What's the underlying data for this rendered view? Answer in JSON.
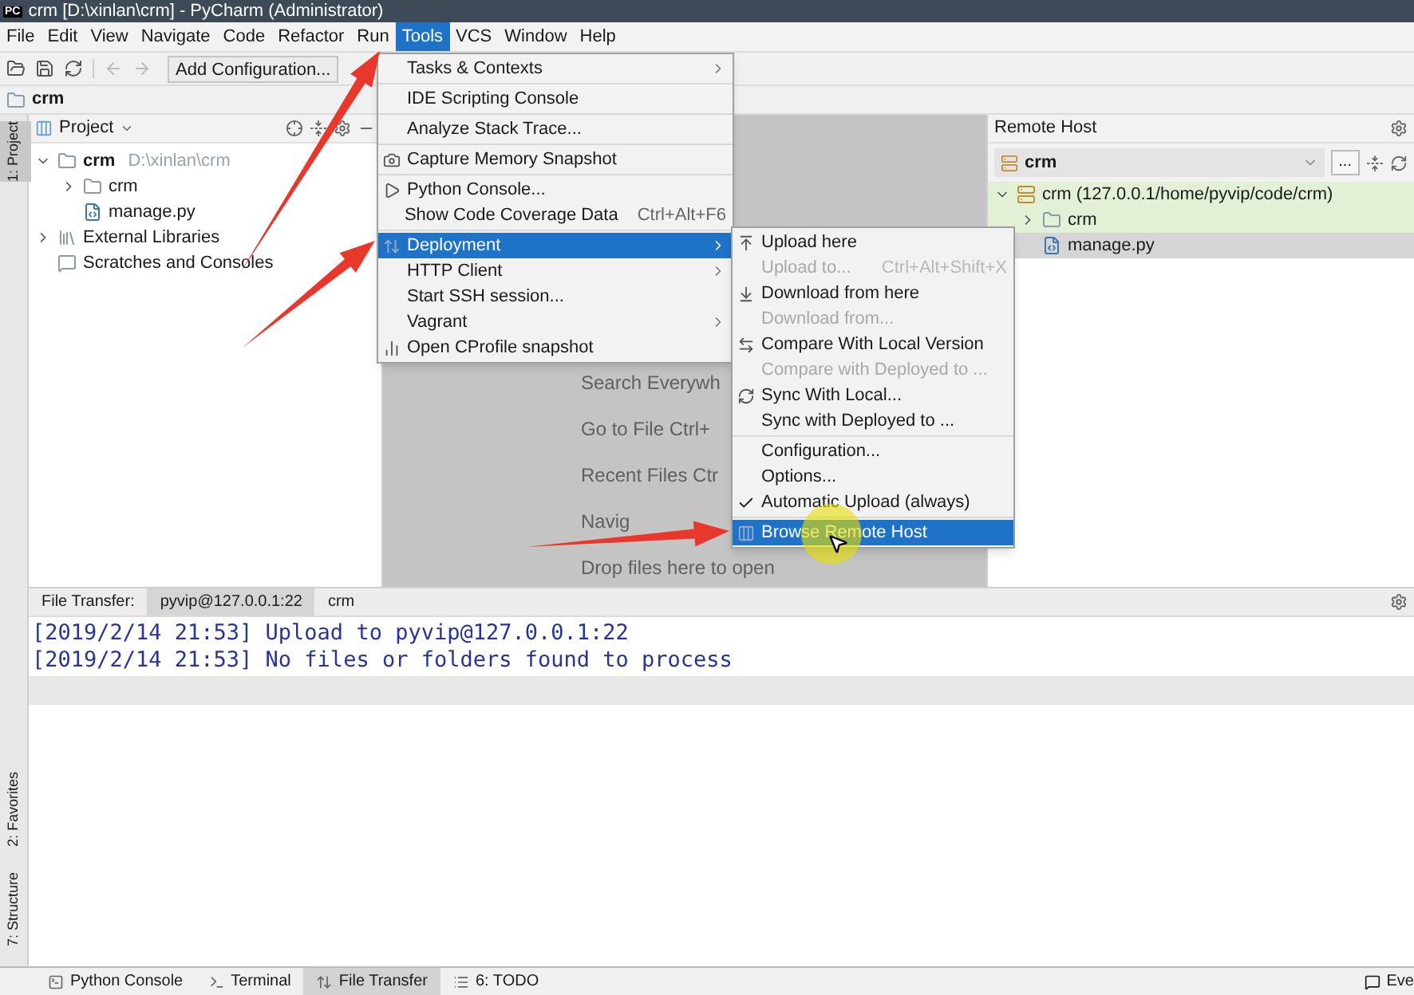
{
  "window": {
    "logo": "PC",
    "title": "crm [D:\\xinlan\\crm] - PyCharm (Administrator)"
  },
  "menu_bar": [
    {
      "label": "File",
      "selected": false
    },
    {
      "label": "Edit",
      "selected": false
    },
    {
      "label": "View",
      "selected": false
    },
    {
      "label": "Navigate",
      "selected": false
    },
    {
      "label": "Code",
      "selected": false
    },
    {
      "label": "Refactor",
      "selected": false
    },
    {
      "label": "Run",
      "selected": false
    },
    {
      "label": "Tools",
      "selected": true
    },
    {
      "label": "VCS",
      "selected": false
    },
    {
      "label": "Window",
      "selected": false
    },
    {
      "label": "Help",
      "selected": false
    }
  ],
  "toolbar": {
    "config_button": "Add Configuration..."
  },
  "breadcrumb": "crm",
  "left_stripe": {
    "top": "1: Project",
    "bottom": [
      "2: Favorites",
      "7: Structure"
    ]
  },
  "project_panel": {
    "title": "Project",
    "tree": [
      {
        "name": "crm",
        "path": "D:\\xinlan\\crm",
        "kind": "folder",
        "expanded": true,
        "children": [
          {
            "name": "crm",
            "kind": "folder",
            "expanded": false
          },
          {
            "name": "manage.py",
            "kind": "python"
          }
        ]
      },
      {
        "name": "External Libraries",
        "kind": "library",
        "expanded": false
      },
      {
        "name": "Scratches and Consoles",
        "kind": "scratch"
      }
    ]
  },
  "editor_hints": [
    "Search Everywh",
    "Go to File Ctrl+",
    "Recent Files Ctr",
    "Navig",
    "Drop files here to open"
  ],
  "tools_menu": {
    "items": [
      {
        "kind": "item",
        "label": "Tasks & Contexts",
        "submenu": true,
        "selected": false
      },
      {
        "kind": "separator"
      },
      {
        "kind": "item",
        "label": "IDE Scripting Console",
        "selected": false
      },
      {
        "kind": "separator"
      },
      {
        "kind": "item",
        "label": "Analyze Stack Trace...",
        "selected": false
      },
      {
        "kind": "separator"
      },
      {
        "kind": "item",
        "label": "Capture Memory Snapshot",
        "selected": false
      },
      {
        "kind": "separator"
      },
      {
        "kind": "item",
        "label": "Python Console...",
        "selected": false
      },
      {
        "kind": "item",
        "label": "Show Code Coverage Data",
        "shortcut": "Ctrl+Alt+F6",
        "selected": false
      },
      {
        "kind": "separator"
      },
      {
        "kind": "item",
        "label": "Deployment",
        "submenu": true,
        "selected": true
      },
      {
        "kind": "item",
        "label": "HTTP Client",
        "submenu": true,
        "selected": false
      },
      {
        "kind": "item",
        "label": "Start SSH session...",
        "selected": false
      },
      {
        "kind": "item",
        "label": "Vagrant",
        "submenu": true,
        "selected": false
      },
      {
        "kind": "item",
        "label": "Open CProfile snapshot",
        "selected": false
      }
    ]
  },
  "deployment_menu": {
    "items": [
      {
        "kind": "item",
        "label": "Upload here",
        "disabled": false,
        "selected": false
      },
      {
        "kind": "item",
        "label": "Upload to...",
        "shortcut": "Ctrl+Alt+Shift+X",
        "disabled": true,
        "selected": false
      },
      {
        "kind": "item",
        "label": "Download from here",
        "disabled": false,
        "selected": false
      },
      {
        "kind": "item",
        "label": "Download from...",
        "disabled": true,
        "selected": false
      },
      {
        "kind": "item",
        "label": "Compare With Local Version",
        "disabled": false,
        "selected": false
      },
      {
        "kind": "item",
        "label": "Compare with Deployed to ...",
        "disabled": true,
        "selected": false
      },
      {
        "kind": "item",
        "label": "Sync With Local...",
        "disabled": false,
        "selected": false
      },
      {
        "kind": "item",
        "label": "Sync with Deployed to ...",
        "disabled": false,
        "selected": false
      },
      {
        "kind": "separator"
      },
      {
        "kind": "item",
        "label": "Configuration...",
        "disabled": false,
        "selected": false
      },
      {
        "kind": "item",
        "label": "Options...",
        "disabled": false,
        "selected": false
      },
      {
        "kind": "item",
        "label": "Automatic Upload (always)",
        "checked": true,
        "disabled": false,
        "selected": false
      },
      {
        "kind": "separator"
      },
      {
        "kind": "item",
        "label": "Browse Remote Host",
        "disabled": false,
        "selected": true
      }
    ]
  },
  "remote_host": {
    "title": "Remote Host",
    "server": "crm",
    "more_button": "...",
    "tree": [
      {
        "name": "crm (127.0.0.1/home/pyvip/code/crm)",
        "kind": "server",
        "expanded": true,
        "selected": false,
        "children": [
          {
            "name": "crm",
            "kind": "folder",
            "expanded": false,
            "selected": false
          },
          {
            "name": "manage.py",
            "kind": "python",
            "selected": true
          }
        ]
      }
    ]
  },
  "file_transfer": {
    "label": "File Transfer:",
    "tabs": [
      {
        "label": "pyvip@127.0.0.1:22",
        "selected": true
      },
      {
        "label": "crm",
        "selected": false
      }
    ],
    "log": [
      "[2019/2/14 21:53] Upload to pyvip@127.0.0.1:22",
      "[2019/2/14 21:53] No files or folders found to process"
    ]
  },
  "bottom_tools": [
    {
      "label": "Python Console",
      "selected": false
    },
    {
      "label": "Terminal",
      "selected": false
    },
    {
      "label": "File Transfer",
      "selected": true
    },
    {
      "label": "6: TODO",
      "selected": false
    }
  ],
  "event_log": "Eve"
}
